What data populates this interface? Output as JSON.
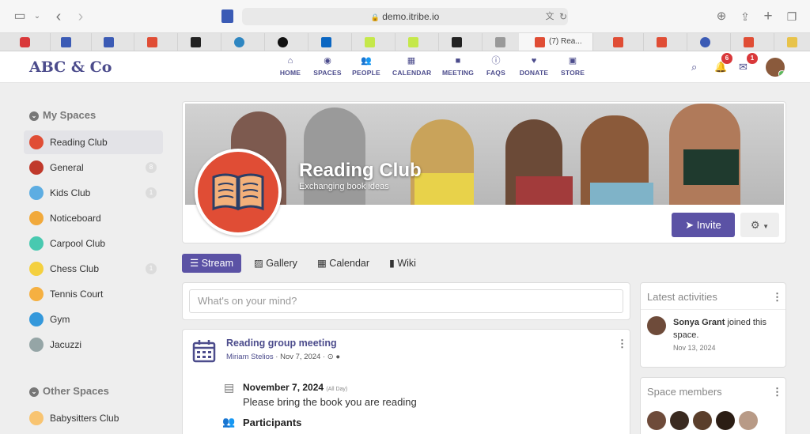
{
  "browser": {
    "url": "demo.itribe.io",
    "active_tab_label": "(7) Rea..."
  },
  "header": {
    "logo": "ABC & Co",
    "nav": [
      {
        "label": "HOME",
        "icon": "home-icon"
      },
      {
        "label": "SPACES",
        "icon": "spaces-icon"
      },
      {
        "label": "PEOPLE",
        "icon": "people-icon"
      },
      {
        "label": "CALENDAR",
        "icon": "calendar-icon"
      },
      {
        "label": "MEETING",
        "icon": "video-icon"
      },
      {
        "label": "FAQS",
        "icon": "info-icon"
      },
      {
        "label": "DONATE",
        "icon": "heart-icon"
      },
      {
        "label": "STORE",
        "icon": "store-icon"
      }
    ],
    "notifications_count": "6",
    "messages_count": "1"
  },
  "sidebar": {
    "my_spaces_title": "My Spaces",
    "my_spaces": [
      {
        "label": "Reading Club",
        "color": "#e04d35",
        "count": ""
      },
      {
        "label": "General",
        "color": "#c0392b",
        "count": "8"
      },
      {
        "label": "Kids Club",
        "color": "#5dade2",
        "count": "1"
      },
      {
        "label": "Noticeboard",
        "color": "#f1a93b",
        "count": ""
      },
      {
        "label": "Carpool Club",
        "color": "#48c9b0",
        "count": ""
      },
      {
        "label": "Chess Club",
        "color": "#f4d03f",
        "count": "1"
      },
      {
        "label": "Tennis Court",
        "color": "#f5b041",
        "count": ""
      },
      {
        "label": "Gym",
        "color": "#3498db",
        "count": ""
      },
      {
        "label": "Jacuzzi",
        "color": "#95a5a6",
        "count": ""
      }
    ],
    "other_spaces_title": "Other Spaces",
    "other_spaces": [
      {
        "label": "Babysitters Club",
        "color": "#f8c471",
        "count": ""
      }
    ]
  },
  "space": {
    "title": "Reading Club",
    "subtitle": "Exchanging book ideas",
    "invite_label": "Invite"
  },
  "tabs": [
    {
      "label": "Stream",
      "icon": "stream-icon"
    },
    {
      "label": "Gallery",
      "icon": "image-icon"
    },
    {
      "label": "Calendar",
      "icon": "calendar-icon"
    },
    {
      "label": "Wiki",
      "icon": "book-icon"
    }
  ],
  "stream": {
    "composer_placeholder": "What's on your mind?",
    "post": {
      "title": "Reading group meeting",
      "author": "Miriam Stelios",
      "date": "Nov 7, 2024",
      "event_date": "November 7, 2024",
      "all_day": "(All Day)",
      "description": "Please bring the book you are reading",
      "participants_label": "Participants"
    }
  },
  "activities": {
    "title": "Latest activities",
    "items": [
      {
        "name": "Sonya Grant",
        "text": "joined this space.",
        "date": "Nov 13, 2024"
      }
    ]
  },
  "members": {
    "title": "Space members"
  },
  "colors": {
    "brand": "#4c4c8c",
    "accent": "#5b52a5",
    "badge": "#d9383a"
  }
}
